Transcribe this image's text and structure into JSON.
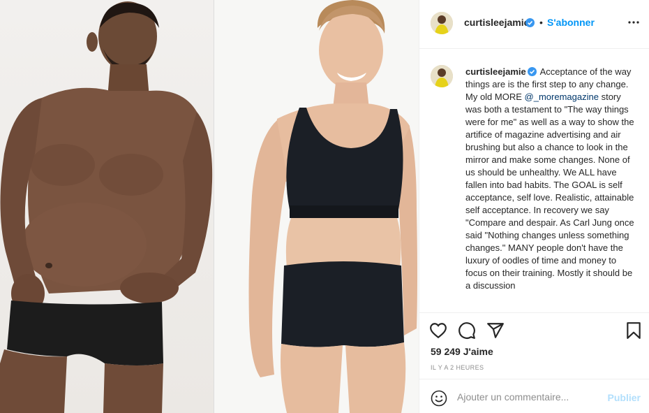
{
  "post": {
    "username": "curtisleejamie",
    "verified_icon": "verified-badge-icon",
    "separator": "•",
    "follow_label": "S'abonner",
    "more_icon": "more-options-icon"
  },
  "media": {
    "left_photo_alt": "man-in-black-briefs-photo",
    "right_photo_alt": "woman-in-black-sports-bra-photo"
  },
  "caption": {
    "text_before_mention": "Acceptance of the way things are is the first step to any change. My old MORE",
    "mention": "@_moremagazine",
    "text_after_mention": "story was both a testament to \"The way things were for me\" as well as a way to show the artifice of magazine advertising and air brushing but also a chance to look in the mirror and make some changes. None of us should be unhealthy. We ALL have fallen into bad habits. The GOAL is self acceptance, self love. Realistic, attainable self acceptance. In recovery we say \"Compare and despair. As Carl Jung once said \"Nothing changes unless something changes.\" MANY people don't have the luxury of oodles of time and money to focus on their training. Mostly it should be a discussion"
  },
  "actions": {
    "like_icon": "heart-icon",
    "comment_icon": "comment-icon",
    "share_icon": "share-icon",
    "save_icon": "bookmark-icon",
    "likes": "59 249 J'aime",
    "timestamp": "IL Y A 2 HEURES"
  },
  "comment": {
    "emoji_icon": "emoji-icon",
    "placeholder": "Ajouter un commentaire...",
    "publish_label": "Publier"
  },
  "colors": {
    "accent": "#0095f6",
    "publish_disabled": "#b2dffc",
    "text": "#262626",
    "muted": "#8e8e8e",
    "border": "#efefef"
  }
}
